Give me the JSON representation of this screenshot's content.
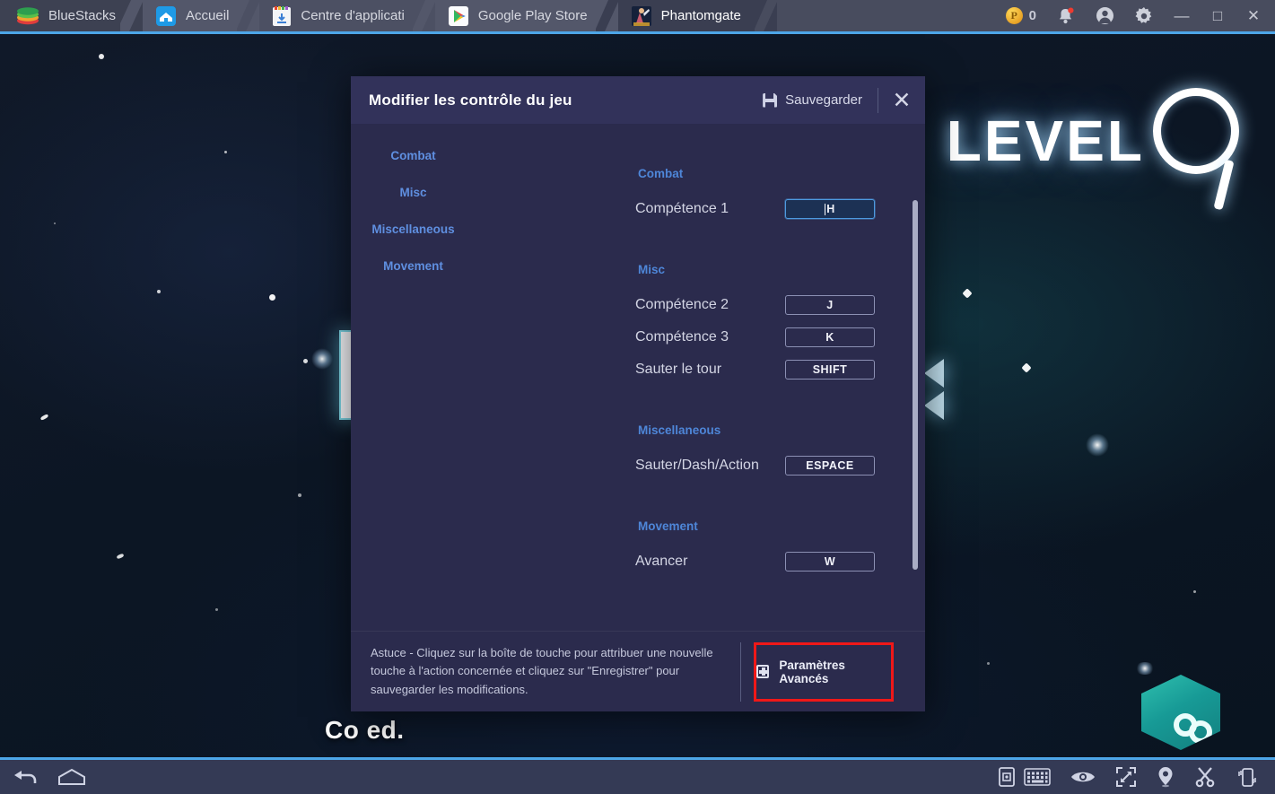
{
  "titlebar": {
    "brand": "BlueStacks",
    "brand_icon": "bluestacks-logo-icon",
    "tabs": [
      {
        "label": "Accueil",
        "icon": "home-icon",
        "active": false
      },
      {
        "label": "Centre d'applicati",
        "icon": "app-center-icon",
        "active": false
      },
      {
        "label": "Google Play Store",
        "icon": "google-play-icon",
        "active": false
      },
      {
        "label": "Phantomgate",
        "icon": "phantomgate-game-icon",
        "active": true
      }
    ],
    "coin_symbol": "P",
    "coin_count": "0",
    "notification_icon": "bell-icon",
    "account_icon": "user-avatar-icon",
    "settings_icon": "gear-icon",
    "minimize_label": "—",
    "maximize_label": "□",
    "close_label": "✕"
  },
  "game": {
    "level_text": "LEVEL",
    "level_number": "9",
    "partial_text": "Co            ed.",
    "hex_button_icon": "link-chain-icon",
    "chevron_icon": "chevron-left-icon"
  },
  "dialog": {
    "title": "Modifier les contrôle du jeu",
    "save_label": "Sauvegarder",
    "save_icon": "save-disk-icon",
    "close_icon": "close-icon",
    "nav": [
      {
        "label": "Combat"
      },
      {
        "label": "Misc"
      },
      {
        "label": "Miscellaneous"
      },
      {
        "label": "Movement"
      }
    ],
    "groups": [
      {
        "title": "Combat",
        "rows": [
          {
            "action": "Compétence 1",
            "key": "H",
            "active": true
          }
        ]
      },
      {
        "title": "Misc",
        "rows": [
          {
            "action": "Compétence 2",
            "key": "J",
            "active": false
          },
          {
            "action": "Compétence 3",
            "key": "K",
            "active": false
          },
          {
            "action": "Sauter le tour",
            "key": "SHIFT",
            "active": false
          }
        ]
      },
      {
        "title": "Miscellaneous",
        "rows": [
          {
            "action": "Sauter/Dash/Action",
            "key": "ESPACE",
            "active": false
          }
        ]
      },
      {
        "title": "Movement",
        "rows": [
          {
            "action": "Avancer",
            "key": "W",
            "active": false
          }
        ]
      }
    ],
    "tip": "Astuce - Cliquez sur la boîte de touche pour attribuer une nouvelle touche à l'action concernée et cliquez sur \"Enregistrer\" pour sauvegarder les modifications.",
    "advanced_label": "Paramètres Avancés",
    "advanced_icon": "advanced-settings-icon",
    "highlight_color": "#f01818",
    "accent_color": "#4e86d8"
  },
  "bottombar": {
    "left_icons": [
      {
        "name": "back-icon"
      },
      {
        "name": "home-icon"
      }
    ],
    "right_icons": [
      {
        "name": "multi-instance-icon"
      },
      {
        "name": "keyboard-controls-icon"
      },
      {
        "name": "eye-icon"
      },
      {
        "name": "fullscreen-icon"
      },
      {
        "name": "location-icon"
      },
      {
        "name": "scissors-icon"
      },
      {
        "name": "shake-device-icon"
      }
    ]
  }
}
